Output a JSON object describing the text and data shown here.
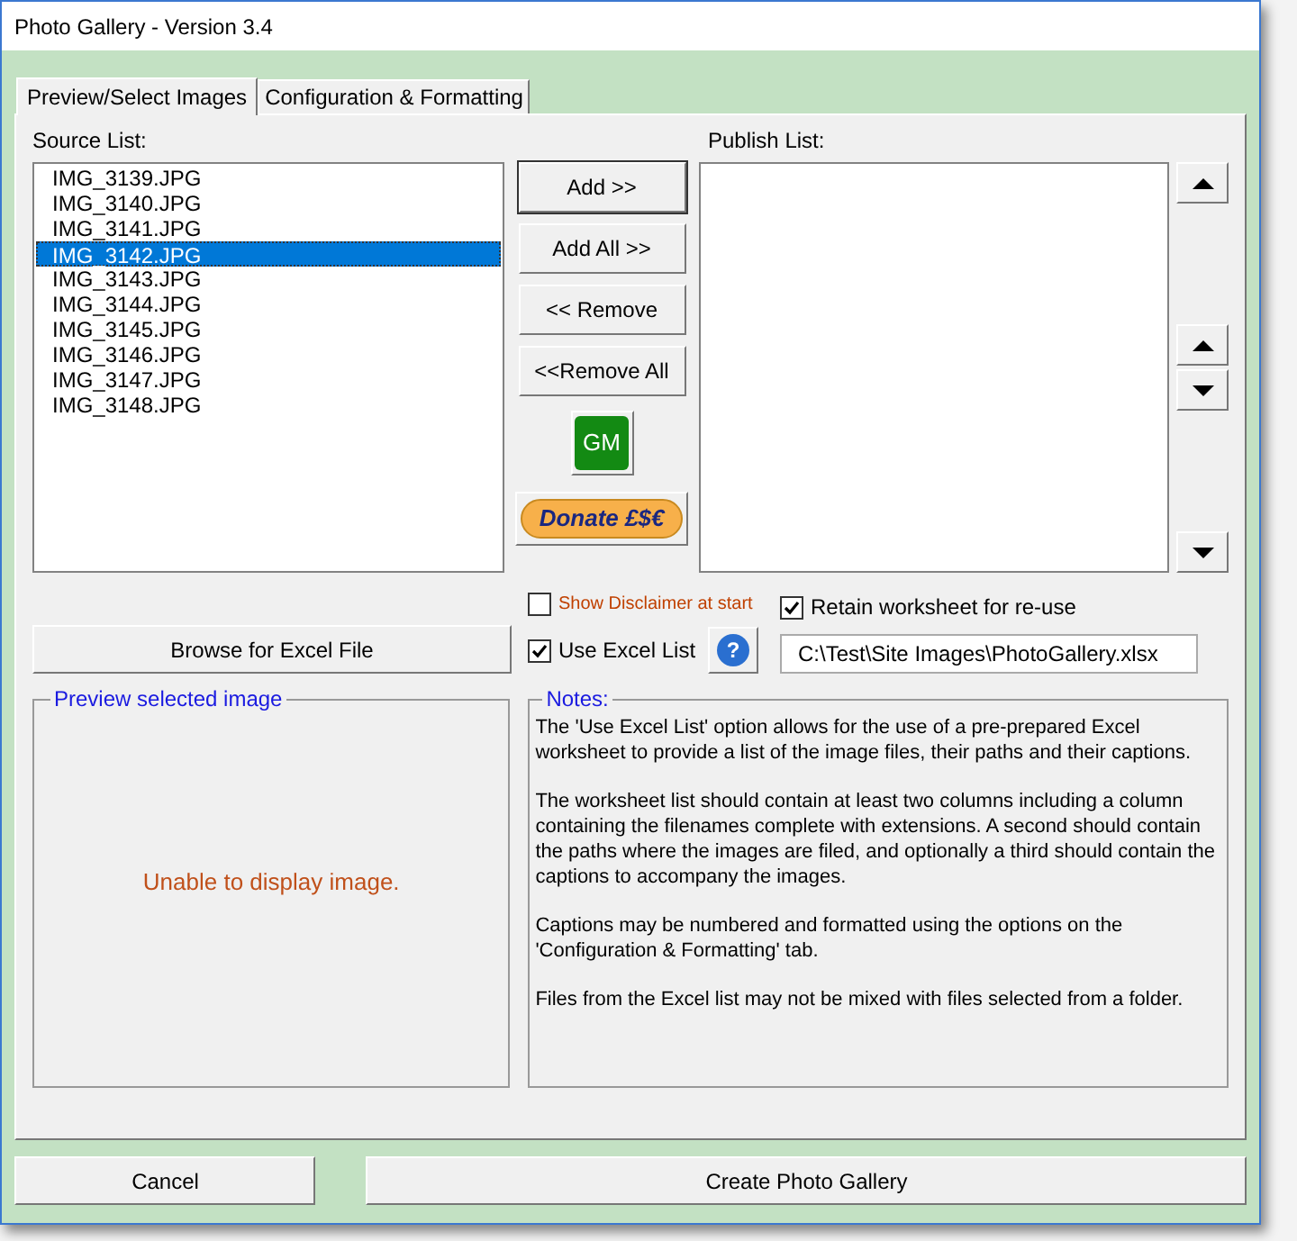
{
  "window": {
    "title": "Photo Gallery - Version 3.4"
  },
  "tabs": [
    {
      "label": "Preview/Select Images",
      "selected": true
    },
    {
      "label": "Configuration & Formatting",
      "selected": false
    }
  ],
  "source_list": {
    "label": "Source List:",
    "items": [
      {
        "name": "IMG_3139.JPG",
        "selected": false
      },
      {
        "name": "IMG_3140.JPG",
        "selected": false
      },
      {
        "name": "IMG_3141.JPG",
        "selected": false
      },
      {
        "name": "IMG_3142.JPG",
        "selected": true
      },
      {
        "name": "IMG_3143.JPG",
        "selected": false
      },
      {
        "name": "IMG_3144.JPG",
        "selected": false
      },
      {
        "name": "IMG_3145.JPG",
        "selected": false
      },
      {
        "name": "IMG_3146.JPG",
        "selected": false
      },
      {
        "name": "IMG_3147.JPG",
        "selected": false
      },
      {
        "name": "IMG_3148.JPG",
        "selected": false
      }
    ]
  },
  "publish_list": {
    "label": "Publish List:"
  },
  "buttons": [
    {
      "label": "Add >>",
      "default": true
    },
    {
      "label": "Add All >>",
      "default": false
    },
    {
      "label": "<< Remove",
      "default": false
    },
    {
      "label": "<<Remove All",
      "default": false
    }
  ],
  "gm_button": {
    "label": "GM"
  },
  "donate_button": {
    "label": "Donate £$€"
  },
  "move_buttons": [
    {
      "kind": "up"
    },
    {
      "kind": "up"
    },
    {
      "kind": "down"
    },
    {
      "kind": "down"
    }
  ],
  "show_disclaimer": {
    "label": "Show Disclaimer at start",
    "checked": false
  },
  "retain_worksheet": {
    "label": "Retain worksheet for re-use",
    "checked": true
  },
  "browse_button": {
    "label": "Browse for Excel File"
  },
  "use_excel_list": {
    "label": "Use Excel List",
    "checked": true
  },
  "help_button": {
    "label": "?"
  },
  "excel_path": {
    "value": "C:\\Test\\Site Images\\PhotoGallery.xlsx"
  },
  "preview": {
    "title": "Preview selected image",
    "message": "Unable to display image."
  },
  "notes": {
    "title": "Notes:",
    "paragraphs": [
      "The 'Use Excel List' option allows for the use of a pre-prepared Excel worksheet to provide a list of the image files, their paths and their captions.",
      "The worksheet list should contain at least two columns including a column containing the filenames complete with extensions. A second should contain the paths where the images are filed, and optionally a third should contain the captions to accompany the images.",
      "Captions may be numbered and formatted using the options on the 'Configuration & Formatting' tab.",
      "Files from the Excel list may not be mixed with files selected from a folder."
    ]
  },
  "footer_buttons": [
    {
      "label": "Cancel"
    },
    {
      "label": "Create Photo Gallery"
    }
  ]
}
